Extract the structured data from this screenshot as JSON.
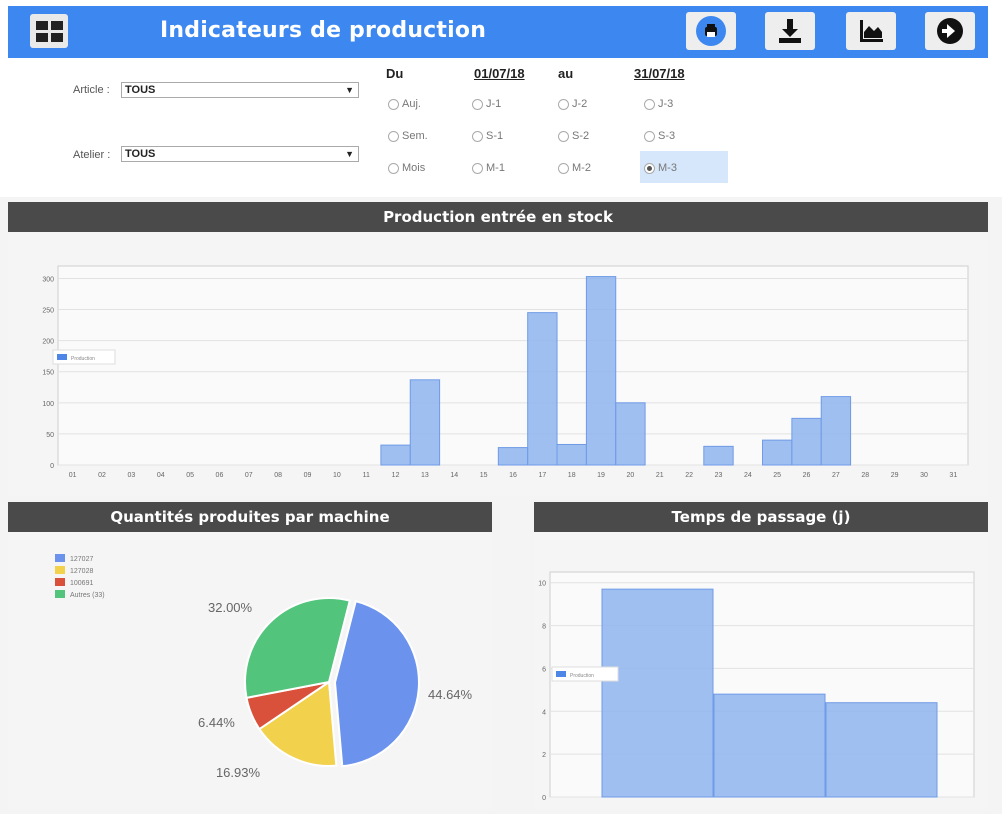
{
  "header": {
    "title": "Indicateurs de production",
    "icons": [
      "menu-grid-icon",
      "print-icon",
      "download-icon",
      "chart-icon",
      "arrow-right-icon"
    ]
  },
  "filters": {
    "article_label": "Article :",
    "article_value": "TOUS",
    "atelier_label": "Atelier :",
    "atelier_value": "TOUS",
    "du_label": "Du",
    "date_from": "01/07/18",
    "au_label": "au",
    "date_to": "31/07/18",
    "radios": [
      [
        "Auj.",
        "J-1",
        "J-2",
        "J-3"
      ],
      [
        "Sem.",
        "S-1",
        "S-2",
        "S-3"
      ],
      [
        "Mois",
        "M-1",
        "M-2",
        "M-3"
      ]
    ],
    "selected": "M-3"
  },
  "sections": {
    "stock": "Production entrée en stock",
    "machines": "Quantités produites par machine",
    "passage": "Temps de passage (j)"
  },
  "chart_data": [
    {
      "type": "bar",
      "title": "Production entrée en stock",
      "categories": [
        "01",
        "02",
        "03",
        "04",
        "05",
        "06",
        "07",
        "08",
        "09",
        "10",
        "11",
        "12",
        "13",
        "14",
        "15",
        "16",
        "17",
        "18",
        "19",
        "20",
        "21",
        "22",
        "23",
        "24",
        "25",
        "26",
        "27",
        "28",
        "29",
        "30",
        "31"
      ],
      "series": [
        {
          "name": "Production",
          "values": [
            0,
            0,
            0,
            0,
            0,
            0,
            0,
            0,
            0,
            0,
            0,
            32,
            137,
            0,
            0,
            28,
            245,
            33,
            303,
            100,
            0,
            0,
            30,
            0,
            40,
            75,
            110,
            0,
            0,
            0,
            0
          ]
        }
      ],
      "ylim": [
        0,
        320
      ],
      "yticks": [
        0,
        50,
        100,
        150,
        200,
        250,
        300
      ],
      "grid": true,
      "legend": "left",
      "color": "#8fb4ee"
    },
    {
      "type": "pie",
      "title": "Quantités produites par machine",
      "labels": [
        "127027",
        "127028",
        "100691",
        "Autres (33)"
      ],
      "values": [
        44.64,
        16.93,
        6.44,
        32.0
      ],
      "value_labels": [
        "44.64%",
        "16.93%",
        "6.44%",
        "32.00%"
      ],
      "colors": [
        "#6b93ee",
        "#f2d14c",
        "#d9513a",
        "#52c47c"
      ],
      "legend": "top-left"
    },
    {
      "type": "bar",
      "title": "Temps de passage (j)",
      "categories": [
        "",
        "",
        ""
      ],
      "series": [
        {
          "name": "Production",
          "values": [
            9.7,
            4.8,
            4.4
          ]
        }
      ],
      "ylim": [
        0,
        10.5
      ],
      "yticks": [
        0,
        2,
        4,
        6,
        8,
        10
      ],
      "grid": true,
      "legend": "left",
      "color": "#8fb4ee"
    }
  ]
}
